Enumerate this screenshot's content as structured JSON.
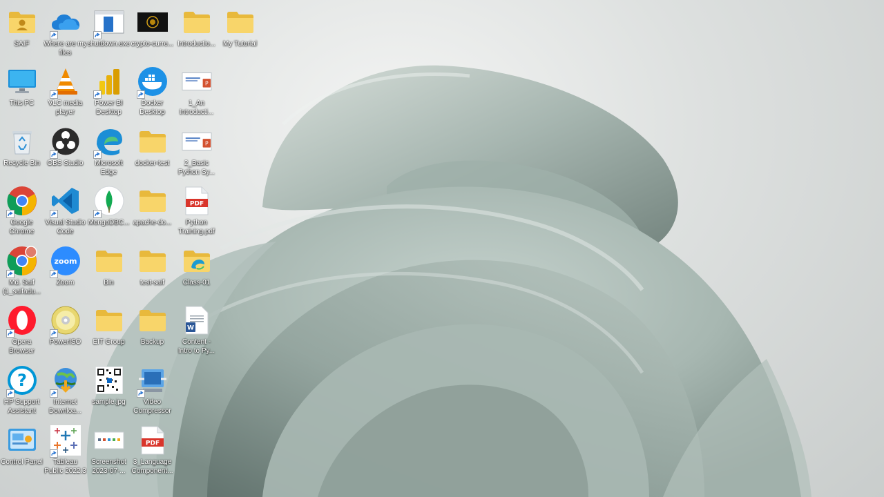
{
  "desktop": {
    "wallpaper_colors": {
      "background": "#dfe2e1",
      "bloom_light": "#b7c7c1",
      "bloom_dark": "#6f807b"
    },
    "icons": [
      {
        "label": "SAIF",
        "icon": "user-folder-icon",
        "shortcut": false
      },
      {
        "label": "Where are my files",
        "icon": "onedrive-icon",
        "shortcut": true
      },
      {
        "label": "shutdown.exe",
        "icon": "executable-file-icon",
        "shortcut": true
      },
      {
        "label": "crypto-curre...",
        "icon": "video-thumbnail-icon",
        "shortcut": false
      },
      {
        "label": "Introductio...",
        "icon": "folder-icon",
        "shortcut": false
      },
      {
        "label": "My Tutorial",
        "icon": "folder-icon",
        "shortcut": false
      },
      {
        "label": "This PC",
        "icon": "monitor-icon",
        "shortcut": false
      },
      {
        "label": "VLC media player",
        "icon": "vlc-cone-icon",
        "shortcut": true
      },
      {
        "label": "Power BI Desktop",
        "icon": "power-bi-icon",
        "shortcut": true
      },
      {
        "label": "Docker Desktop",
        "icon": "docker-whale-icon",
        "shortcut": true
      },
      {
        "label": "1_An Introducti...",
        "icon": "powerpoint-file-icon",
        "shortcut": false
      },
      {
        "label": "Recycle Bin",
        "icon": "recycle-bin-icon",
        "shortcut": false
      },
      {
        "label": "OBS Studio",
        "icon": "obs-studio-icon",
        "shortcut": true
      },
      {
        "label": "Microsoft Edge",
        "icon": "edge-browser-icon",
        "shortcut": true
      },
      {
        "label": "docker-test",
        "icon": "folder-icon",
        "shortcut": false
      },
      {
        "label": "2_Basic Python Sy...",
        "icon": "powerpoint-file-icon",
        "shortcut": false
      },
      {
        "label": "Google Chrome",
        "icon": "chrome-browser-icon",
        "shortcut": true
      },
      {
        "label": "Visual Studio Code",
        "icon": "vscode-icon",
        "shortcut": true
      },
      {
        "label": "MongoDBC...",
        "icon": "mongodb-leaf-icon",
        "shortcut": true
      },
      {
        "label": "apache-do...",
        "icon": "folder-icon",
        "shortcut": false
      },
      {
        "label": "Python Training.pdf",
        "icon": "pdf-file-icon",
        "shortcut": false
      },
      {
        "label": "Md. Saif (1_saifadu...",
        "icon": "chrome-profile-icon",
        "shortcut": true
      },
      {
        "label": "Zoom",
        "icon": "zoom-app-icon",
        "shortcut": true
      },
      {
        "label": "Bin",
        "icon": "folder-icon",
        "shortcut": false
      },
      {
        "label": "test-saif",
        "icon": "folder-icon",
        "shortcut": false
      },
      {
        "label": "Class-01",
        "icon": "edge-folder-icon",
        "shortcut": false
      },
      {
        "label": "Opera Browser",
        "icon": "opera-browser-icon",
        "shortcut": true
      },
      {
        "label": "PowerISO",
        "icon": "poweriso-disc-icon",
        "shortcut": true
      },
      {
        "label": "EIT Group",
        "icon": "folder-icon",
        "shortcut": false
      },
      {
        "label": "Backup",
        "icon": "folder-icon",
        "shortcut": false
      },
      {
        "label": "Content - Intro to Py...",
        "icon": "word-document-icon",
        "shortcut": false
      },
      {
        "label": "HP Support Assistant",
        "icon": "help-question-icon",
        "shortcut": true
      },
      {
        "label": "Internet Downloa...",
        "icon": "internet-download-manager-icon",
        "shortcut": true
      },
      {
        "label": "sample.jpg",
        "icon": "qr-code-image-icon",
        "shortcut": false
      },
      {
        "label": "Video Compressor",
        "icon": "video-compressor-icon",
        "shortcut": true
      },
      {
        "label": "Control Panel",
        "icon": "control-panel-icon",
        "shortcut": false
      },
      {
        "label": "Tableau Public 2022.3",
        "icon": "tableau-icon",
        "shortcut": true
      },
      {
        "label": "Screenshot 2023-07-...",
        "icon": "screenshot-image-icon",
        "shortcut": false
      },
      {
        "label": "3_Language Component...",
        "icon": "pdf-file-icon",
        "shortcut": false
      }
    ]
  }
}
